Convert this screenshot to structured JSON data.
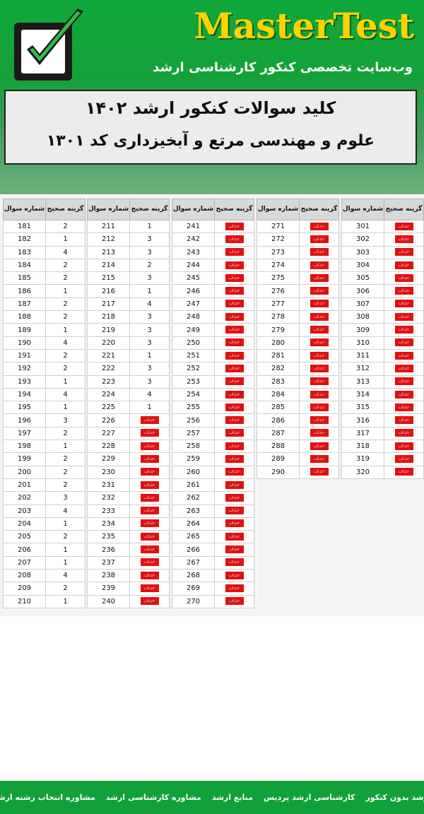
{
  "header": {
    "brand": "MasterTest",
    "tagline": "وب‌سایت تخصصی کنکور کارشناسی ارشد"
  },
  "title": {
    "line1": "کلید سوالات کنکور ارشد ۱۴۰۲",
    "line2": "علوم و مهندسی مرتع و آبخیزداری کد ۱۳۰۱"
  },
  "table_headers": {
    "question": "شماره سوال",
    "answer": "گزینه صحیح"
  },
  "cancelled_label": "حذف",
  "colors": {
    "header_green": "#12a03a",
    "brand_yellow": "#ffd200",
    "cancel_red": "#e01111"
  },
  "answer_key": [
    {
      "start": 181,
      "answers": [
        "2",
        "1",
        "4",
        "2",
        "2",
        "1",
        "2",
        "2",
        "1",
        "4",
        "2",
        "2",
        "1",
        "4",
        "1",
        "3",
        "2",
        "1",
        "2",
        "2",
        "2",
        "3",
        "4",
        "1",
        "2",
        "1",
        "1",
        "4",
        "2",
        "1"
      ]
    },
    {
      "start": 211,
      "answers": [
        "1",
        "3",
        "3",
        "2",
        "3",
        "1",
        "4",
        "3",
        "3",
        "3",
        "1",
        "3",
        "3",
        "4",
        "1",
        "x",
        "x",
        "x",
        "x",
        "x",
        "x",
        "x",
        "x",
        "x",
        "x",
        "x",
        "x",
        "x",
        "x",
        "x"
      ]
    },
    {
      "start": 241,
      "answers": [
        "x",
        "x",
        "x",
        "x",
        "x",
        "x",
        "x",
        "x",
        "x",
        "x",
        "x",
        "x",
        "x",
        "x",
        "x",
        "x",
        "x",
        "x",
        "x",
        "x",
        "x",
        "x",
        "x",
        "x",
        "x",
        "x",
        "x",
        "x",
        "x",
        "x"
      ]
    },
    {
      "start": 271,
      "answers": [
        "x",
        "x",
        "x",
        "x",
        "x",
        "x",
        "x",
        "x",
        "x",
        "x",
        "x",
        "x",
        "x",
        "x",
        "x",
        "x",
        "x",
        "x",
        "x",
        "x",
        "",
        "",
        "",
        "",
        "",
        "",
        "",
        "",
        "",
        ""
      ]
    },
    {
      "start": 301,
      "answers": [
        "x",
        "x",
        "x",
        "x",
        "x",
        "x",
        "x",
        "x",
        "x",
        "x",
        "x",
        "x",
        "x",
        "x",
        "x",
        "x",
        "x",
        "x",
        "x",
        "x"
      ]
    }
  ],
  "footer_links": [
    "ارشد بدون کنکور",
    "کارشناسی ارشد پردیس",
    "منابع ارشد",
    "مشاوره کارشناسی ارشد",
    "مشاوره انتخاب رشته ارشد"
  ]
}
